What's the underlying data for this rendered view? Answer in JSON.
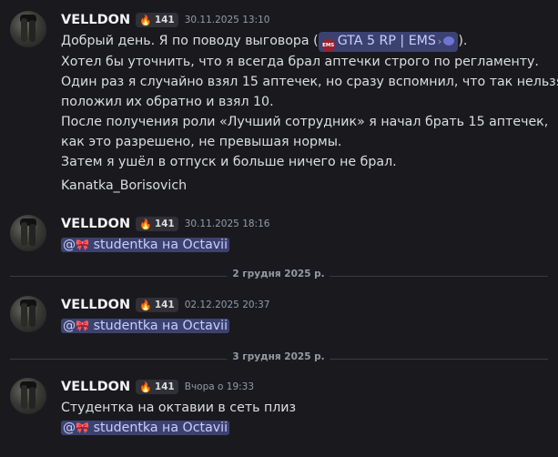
{
  "messages": [
    {
      "username": "VELLDON",
      "badge": "141",
      "timestamp": "30.11.2025 13:10",
      "lines": [
        "Добрый день. Я по поводу выговора (",
        "Хотел бы уточнить, что я всегда брал аптечки строго по регламенту.",
        "Один раз я случайно взял 15 аптечек, но сразу вспомнил, что так нельзя,",
        "положил их обратно и взял 10.",
        "После получения роли «Лучший сотрудник» я начал брать 15 аптечек,",
        "как это разрешено, не превышая нормы.",
        "Затем я ушёл в отпуск и больше ничего не брал."
      ],
      "channel": {
        "icon": "EMS",
        "name": "GTA 5 RP | EMS",
        "line_end": ")."
      },
      "signature": "Kanatka_Borisovich"
    },
    {
      "username": "VELLDON",
      "badge": "141",
      "timestamp": "30.11.2025 18:16",
      "mention": "studentka на Octavii"
    },
    {
      "username": "VELLDON",
      "badge": "141",
      "timestamp": "02.12.2025 20:37",
      "mention": "studentka на Octavii"
    },
    {
      "username": "VELLDON",
      "badge": "141",
      "timestamp": "Вчора о 19:33",
      "text": "Студентка на октавии в сеть плиз",
      "mention": "studentka на Octavii"
    }
  ],
  "dividers": [
    "2 грудня 2025 р.",
    "3 грудня 2025 р."
  ],
  "colors": {
    "background": "#1a1a1e",
    "mention_bg": "#3c4270",
    "mention_text": "#c9cdfb"
  }
}
